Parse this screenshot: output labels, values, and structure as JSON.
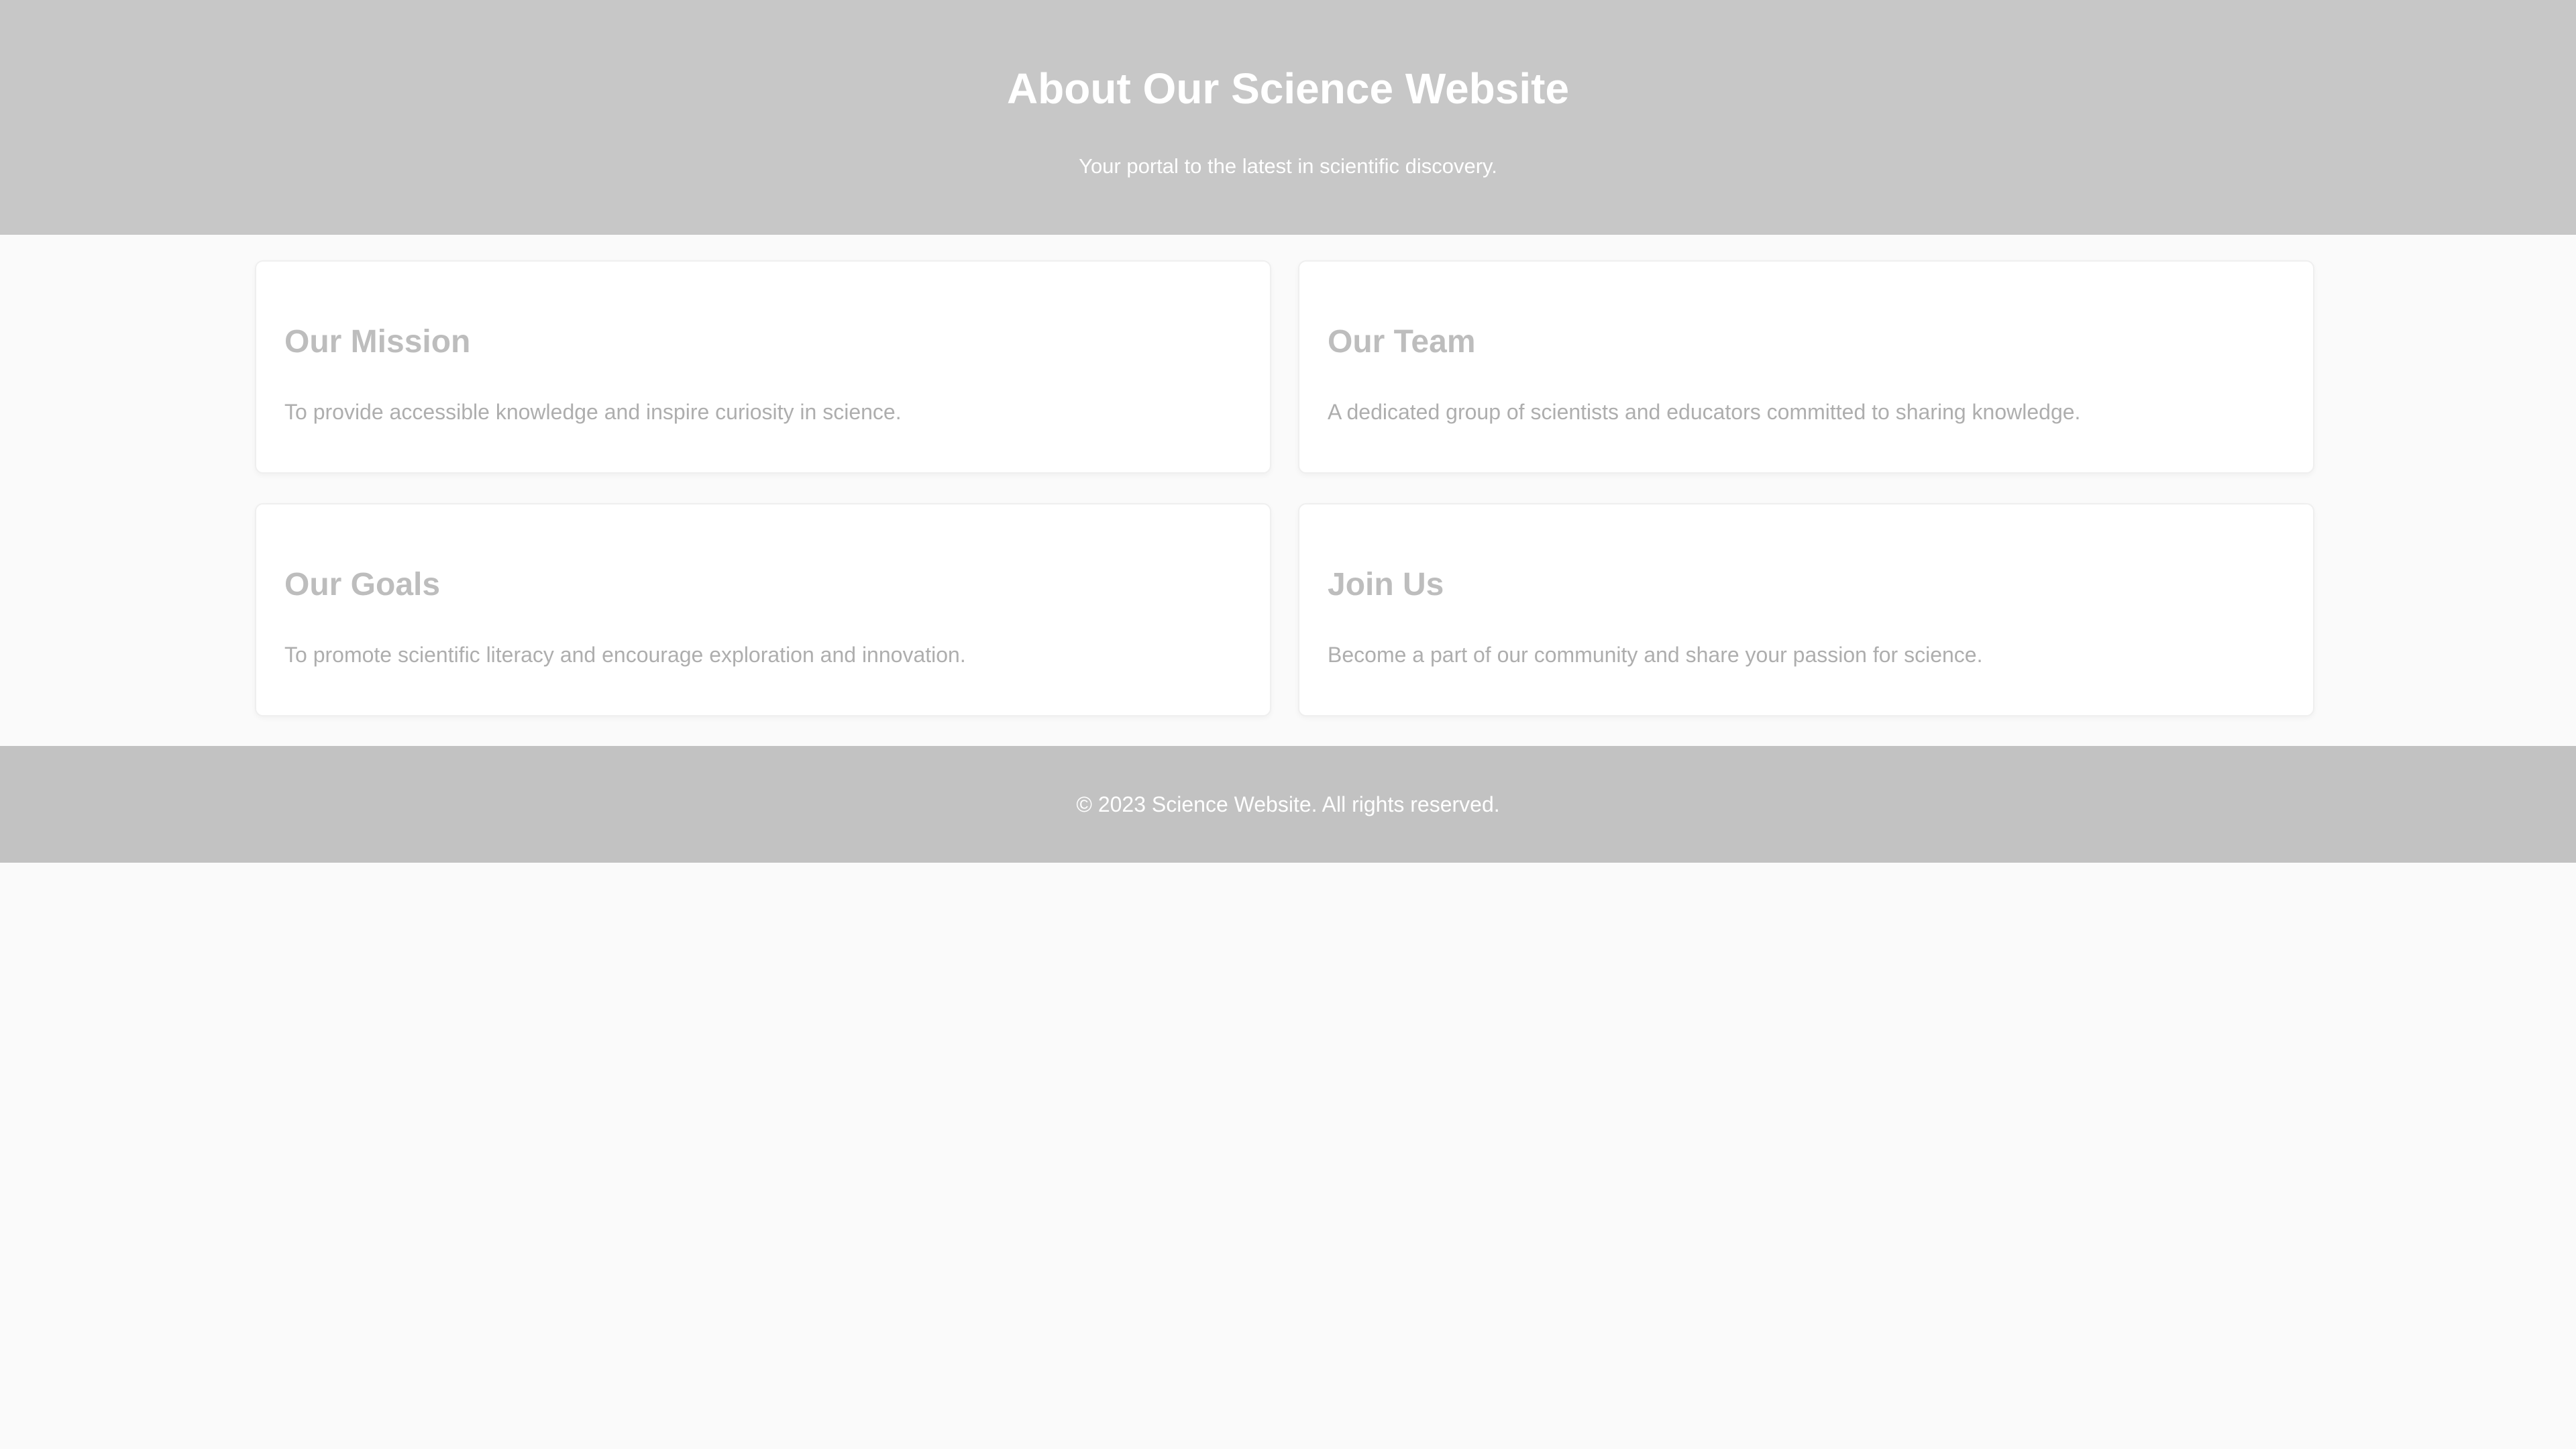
{
  "header": {
    "title": "About Our Science Website",
    "subtitle": "Your portal to the latest in scientific discovery."
  },
  "cards": [
    {
      "title": "Our Mission",
      "text": "To provide accessible knowledge and inspire curiosity in science."
    },
    {
      "title": "Our Team",
      "text": "A dedicated group of scientists and educators committed to sharing knowledge."
    },
    {
      "title": "Our Goals",
      "text": "To promote scientific literacy and encourage exploration and innovation."
    },
    {
      "title": "Join Us",
      "text": "Become a part of our community and share your passion for science."
    }
  ],
  "footer": {
    "text": "© 2023 Science Website. All rights reserved."
  },
  "colors": {
    "header_bg": "#c7c7c7",
    "footer_bg": "#c2c2c2",
    "page_bg": "#fafafa",
    "card_bg": "#ffffff",
    "card_title": "#bdbdbd",
    "card_text": "#aeaeae"
  }
}
